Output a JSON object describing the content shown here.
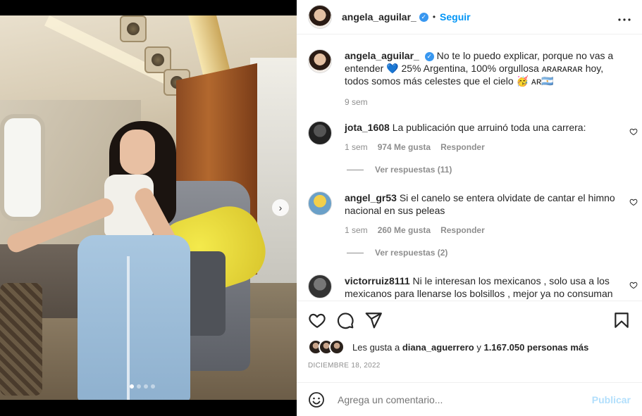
{
  "post": {
    "username": "angela_aguilar_",
    "follow_label": "Seguir",
    "bullet": "•",
    "more_label": "•••",
    "carousel_dots": 4,
    "active_dot": 0
  },
  "caption": {
    "username": "angela_aguilar_",
    "text": "No te lo puedo explicar, porque no vas a entender 💙 25% Argentina, 100% orgullosa ᴀʀᴀʀᴀʀᴀʀ hoy, todos somos más celestes que el cielo 🥳 ᴀʀ🇦🇷",
    "time": "9 sem"
  },
  "comments": [
    {
      "username": "jota_1608",
      "text": "La publicación que arruinó toda una carrera:",
      "time": "1 sem",
      "likes": "974 Me gusta",
      "reply": "Responder",
      "view_replies": "Ver respuestas (11)"
    },
    {
      "username": "angel_gr53",
      "text": "Si el canelo se entera olvidate de cantar el himno nacional en sus peleas",
      "time": "1 sem",
      "likes": "260 Me gusta",
      "reply": "Responder",
      "view_replies": "Ver respuestas (2)"
    },
    {
      "username": "victorruiz8111",
      "text": "Ni le interesan los mexicanos , solo usa a los mexicanos para llenarse los bolsillos , mejor ya no consuman"
    }
  ],
  "likes": {
    "prefix": "Les gusta a",
    "user": "diana_aguerrero",
    "conj": "y",
    "count": "1.167.050 personas más"
  },
  "date": "DICIEMBRE 18, 2022",
  "add_comment": {
    "placeholder": "Agrega un comentario...",
    "publish": "Publicar"
  },
  "colors": {
    "link": "#0095f6",
    "verified": "#3897f0",
    "muted": "#8e8e8e"
  }
}
